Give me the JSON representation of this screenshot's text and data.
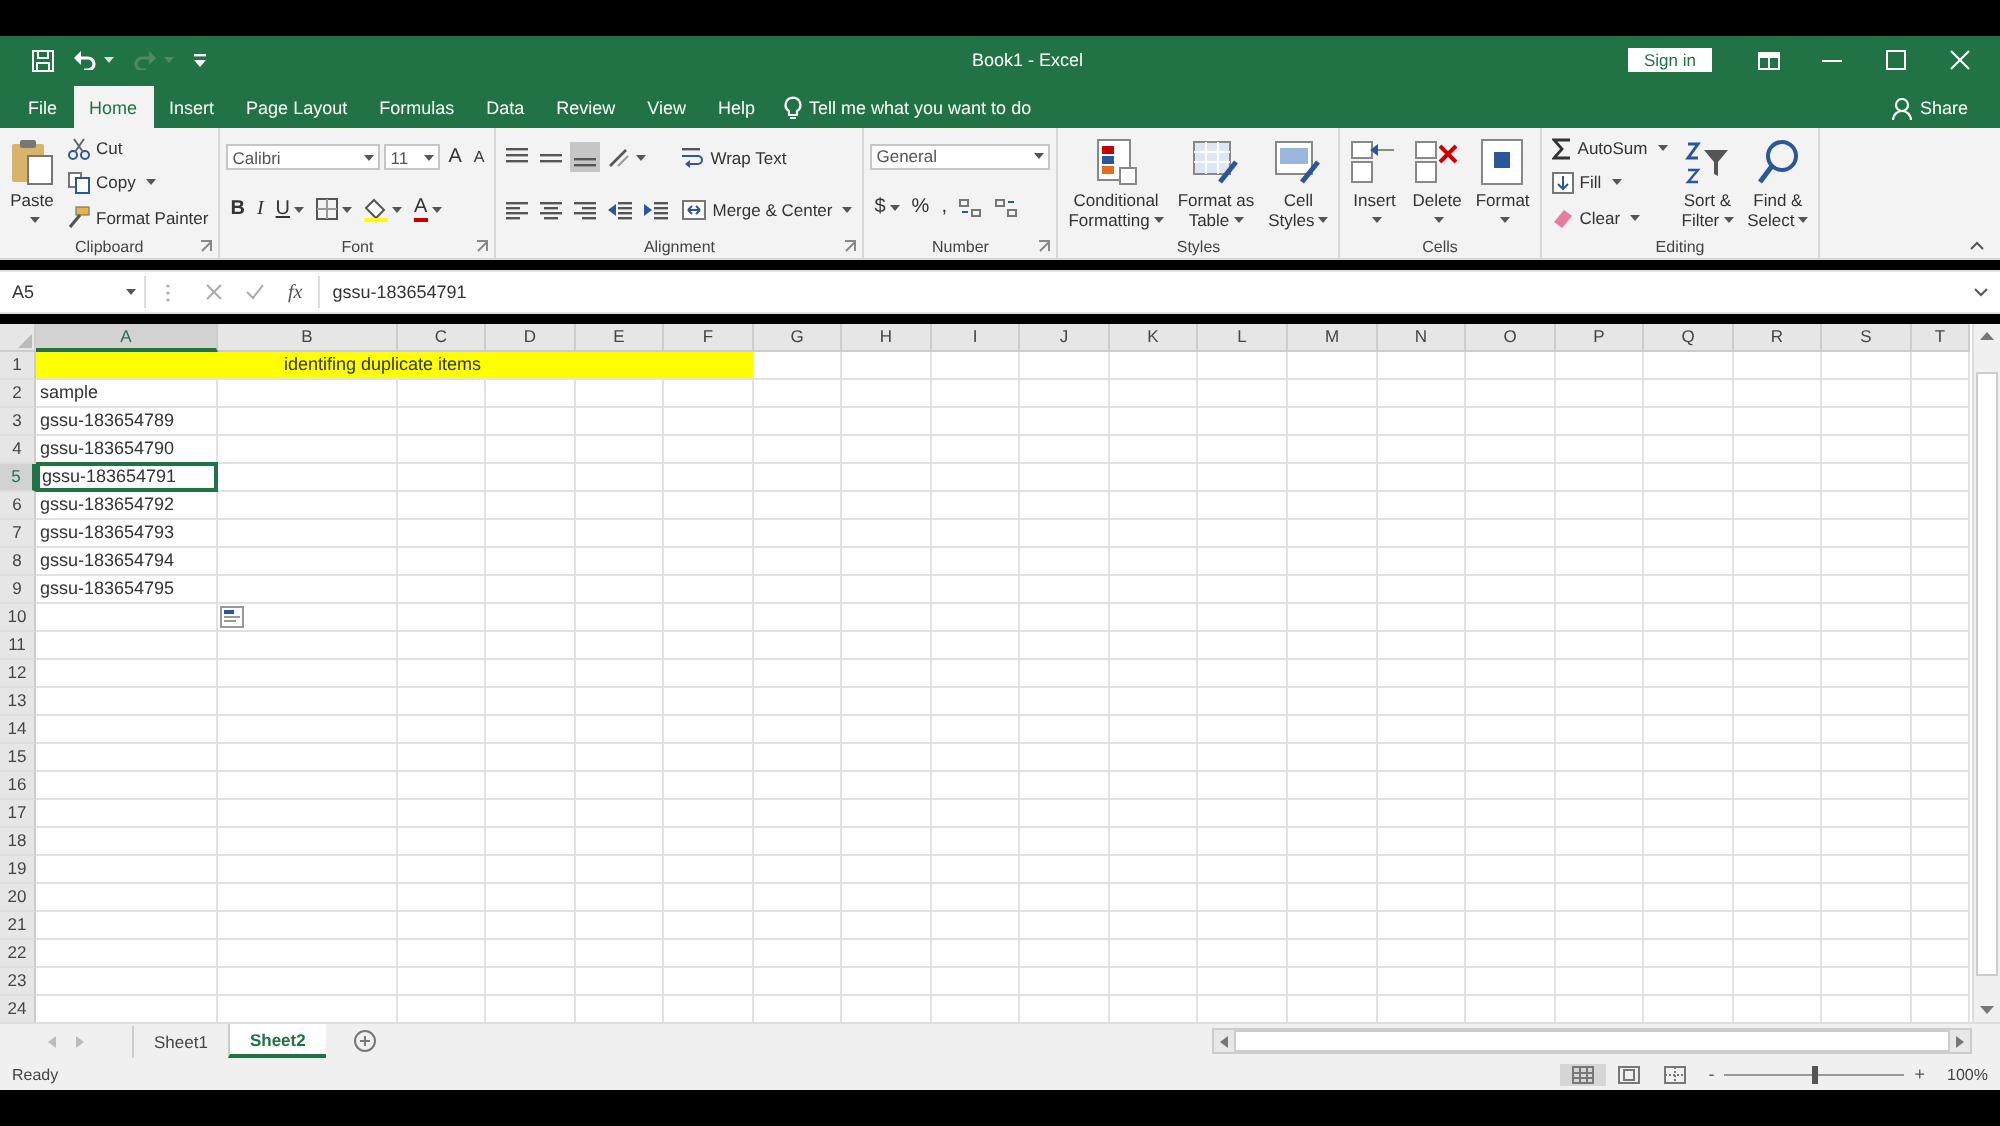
{
  "window": {
    "title": "Book1 - Excel",
    "sign_in": "Sign in"
  },
  "quick_access": [
    {
      "kind": "save",
      "disabled": false
    },
    {
      "kind": "undo",
      "disabled": false
    },
    {
      "kind": "redo",
      "disabled": true
    },
    {
      "kind": "customize",
      "disabled": false
    }
  ],
  "tabs": [
    {
      "label": "File",
      "selected": false
    },
    {
      "label": "Home",
      "selected": true
    },
    {
      "label": "Insert",
      "selected": false
    },
    {
      "label": "Page Layout",
      "selected": false
    },
    {
      "label": "Formulas",
      "selected": false
    },
    {
      "label": "Data",
      "selected": false
    },
    {
      "label": "Review",
      "selected": false
    },
    {
      "label": "View",
      "selected": false
    },
    {
      "label": "Help",
      "selected": false
    }
  ],
  "tell_me": "Tell me what you want to do",
  "share": "Share",
  "ribbon": [
    {
      "label": "Clipboard",
      "launcher": true,
      "columns": [
        [
          [
            {
              "kind": "large",
              "lines": [
                "Paste"
              ],
              "caret": true
            }
          ]
        ],
        [
          [
            {
              "kind": "small",
              "label": "Cut"
            }
          ],
          [
            {
              "kind": "small",
              "label": "Copy",
              "caret": true
            }
          ],
          [
            {
              "kind": "small",
              "label": "Format Painter"
            }
          ]
        ]
      ]
    },
    {
      "label": "Font",
      "launcher": true,
      "columns": [
        [
          [
            {
              "kind": "font-field",
              "value": "Calibri"
            },
            {
              "kind": "size-field",
              "value": "11"
            },
            {
              "kind": "char",
              "label": "A"
            },
            {
              "kind": "small-char",
              "label": "A"
            }
          ],
          [
            {
              "kind": "bold",
              "label": "B"
            },
            {
              "kind": "italic",
              "label": "I"
            },
            {
              "kind": "underline",
              "label": "U",
              "caret": true
            },
            {
              "kind": "icon",
              "caret": true
            },
            {
              "kind": "icon",
              "caret": true
            },
            {
              "kind": "font-color",
              "label": "A",
              "caret": true
            }
          ]
        ]
      ]
    },
    {
      "label": "Alignment",
      "launcher": true,
      "columns": [
        [
          [
            {
              "kind": "icon",
              "selected": false
            },
            {
              "kind": "icon",
              "selected": false
            },
            {
              "kind": "icon",
              "selected": true
            },
            {
              "kind": "icon",
              "caret": true
            }
          ],
          [
            {
              "kind": "icon",
              "selected": false
            },
            {
              "kind": "icon",
              "selected": false
            },
            {
              "kind": "icon",
              "selected": false
            },
            {
              "kind": "icon"
            },
            {
              "kind": "icon"
            }
          ]
        ],
        [
          [
            {
              "kind": "small",
              "label": "Wrap Text"
            }
          ],
          [
            {
              "kind": "small",
              "label": "Merge & Center",
              "caret": true
            }
          ]
        ]
      ]
    },
    {
      "label": "Number",
      "launcher": true,
      "columns": [
        [
          [
            {
              "kind": "format-field",
              "value": "General"
            }
          ],
          [
            {
              "kind": "char",
              "label": "$",
              "caret": true
            },
            {
              "kind": "char",
              "label": "%"
            },
            {
              "kind": "char",
              "label": ","
            },
            {
              "kind": "icon"
            },
            {
              "kind": "icon"
            }
          ]
        ]
      ]
    },
    {
      "label": "Styles",
      "columns": [
        [
          [
            {
              "kind": "large",
              "lines": [
                "Conditional",
                "Formatting"
              ],
              "caret": true
            }
          ]
        ],
        [
          [
            {
              "kind": "large",
              "lines": [
                "Format as",
                "Table"
              ],
              "caret": true
            }
          ]
        ],
        [
          [
            {
              "kind": "large",
              "lines": [
                "Cell",
                "Styles"
              ],
              "caret": true
            }
          ]
        ]
      ]
    },
    {
      "label": "Cells",
      "columns": [
        [
          [
            {
              "kind": "large",
              "lines": [
                "Insert"
              ],
              "caret": true
            }
          ]
        ],
        [
          [
            {
              "kind": "large",
              "lines": [
                "Delete"
              ],
              "caret": true
            }
          ]
        ],
        [
          [
            {
              "kind": "large",
              "lines": [
                "Format"
              ],
              "caret": true
            }
          ]
        ]
      ]
    },
    {
      "label": "Editing",
      "columns": [
        [
          [
            {
              "kind": "small",
              "label": "AutoSum",
              "caret": true
            }
          ],
          [
            {
              "kind": "small",
              "label": "Fill",
              "caret": true
            }
          ],
          [
            {
              "kind": "small",
              "label": "Clear",
              "caret": true
            }
          ]
        ],
        [
          [
            {
              "kind": "large",
              "lines": [
                "Sort &",
                "Filter"
              ],
              "caret": true
            }
          ]
        ],
        [
          [
            {
              "kind": "large",
              "lines": [
                "Find &",
                "Select"
              ],
              "caret": true
            }
          ]
        ]
      ]
    }
  ],
  "formula_bar": {
    "name_box": "A5",
    "fx": "fx",
    "value": "gssu-183654791"
  },
  "sheet": {
    "columns": [
      {
        "label": "A",
        "selected": true
      },
      {
        "label": "B",
        "selected": false
      },
      {
        "label": "C",
        "selected": false
      },
      {
        "label": "D",
        "selected": false
      },
      {
        "label": "E",
        "selected": false
      },
      {
        "label": "F",
        "selected": false
      },
      {
        "label": "G",
        "selected": false
      },
      {
        "label": "H",
        "selected": false
      },
      {
        "label": "I",
        "selected": false
      },
      {
        "label": "J",
        "selected": false
      },
      {
        "label": "K",
        "selected": false
      },
      {
        "label": "L",
        "selected": false
      },
      {
        "label": "M",
        "selected": false
      },
      {
        "label": "N",
        "selected": false
      },
      {
        "label": "O",
        "selected": false
      },
      {
        "label": "P",
        "selected": false
      },
      {
        "label": "Q",
        "selected": false
      },
      {
        "label": "R",
        "selected": false
      },
      {
        "label": "S",
        "selected": false
      },
      {
        "label": "T",
        "selected": false
      }
    ],
    "rows": [
      {
        "label": "1",
        "selected": false,
        "cells": [
          {
            "text": "",
            "color": "#ffff00"
          },
          {
            "text": "identifing duplicate items",
            "color": "#ffff00"
          },
          {
            "text": "",
            "color": "#ffff00"
          },
          {
            "text": "",
            "color": "#ffff00"
          },
          {
            "text": "",
            "color": "#ffff00"
          }
        ]
      },
      {
        "label": "2",
        "selected": false,
        "cells": [
          {
            "text": "sample"
          }
        ]
      },
      {
        "label": "3",
        "selected": false,
        "cells": [
          {
            "text": "gssu-183654789"
          }
        ]
      },
      {
        "label": "4",
        "selected": false,
        "cells": [
          {
            "text": "gssu-183654790"
          }
        ]
      },
      {
        "label": "5",
        "selected": true,
        "cells": [
          {
            "text": "gssu-183654791",
            "active": true
          }
        ]
      },
      {
        "label": "6",
        "selected": false,
        "cells": [
          {
            "text": "gssu-183654792"
          }
        ]
      },
      {
        "label": "7",
        "selected": false,
        "cells": [
          {
            "text": "gssu-183654793"
          }
        ]
      },
      {
        "label": "8",
        "selected": false,
        "cells": [
          {
            "text": "gssu-183654794"
          }
        ]
      },
      {
        "label": "9",
        "selected": false,
        "cells": [
          {
            "text": "gssu-183654795"
          }
        ]
      },
      {
        "label": "10",
        "selected": false,
        "cells": []
      },
      {
        "label": "11",
        "selected": false,
        "cells": []
      },
      {
        "label": "12",
        "selected": false,
        "cells": []
      },
      {
        "label": "13",
        "selected": false,
        "cells": []
      },
      {
        "label": "14",
        "selected": false,
        "cells": []
      },
      {
        "label": "15",
        "selected": false,
        "cells": []
      },
      {
        "label": "16",
        "selected": false,
        "cells": []
      },
      {
        "label": "17",
        "selected": false,
        "cells": []
      },
      {
        "label": "18",
        "selected": false,
        "cells": []
      },
      {
        "label": "19",
        "selected": false,
        "cells": []
      },
      {
        "label": "20",
        "selected": false,
        "cells": []
      },
      {
        "label": "21",
        "selected": false,
        "cells": []
      },
      {
        "label": "22",
        "selected": false,
        "cells": []
      },
      {
        "label": "23",
        "selected": false,
        "cells": []
      },
      {
        "label": "24",
        "selected": false,
        "cells": []
      }
    ]
  },
  "sheet_tabs": [
    {
      "label": "Sheet1",
      "selected": false
    },
    {
      "label": "Sheet2",
      "selected": true
    }
  ],
  "status_bar": {
    "text": "Ready",
    "zoom": {
      "minus": "-",
      "plus": "+",
      "level": 0.5,
      "reading": "100%"
    },
    "views": [
      {
        "selected": true
      },
      {
        "selected": false
      },
      {
        "selected": false
      }
    ]
  }
}
